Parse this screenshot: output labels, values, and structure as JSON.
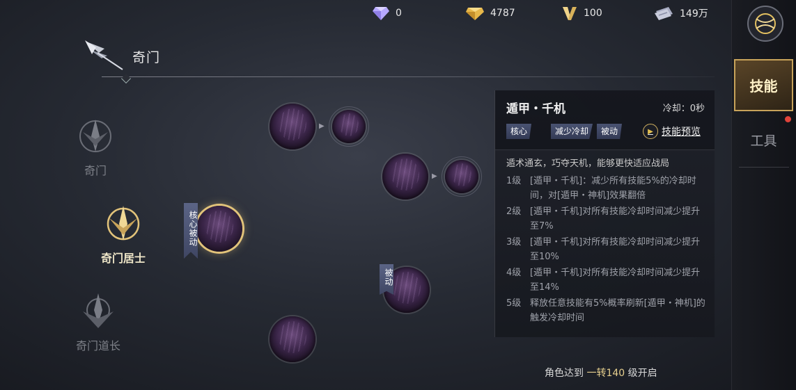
{
  "currencies": [
    {
      "icon": "diamond-icon",
      "value": "0"
    },
    {
      "icon": "gold-ingot-icon",
      "value": "4787"
    },
    {
      "icon": "v-points-icon",
      "value": "100"
    },
    {
      "icon": "silver-ticket-icon",
      "value": "149万"
    }
  ],
  "header": {
    "title": "奇门"
  },
  "classes": [
    {
      "label": "奇门",
      "state": "locked"
    },
    {
      "label": "奇门居士",
      "state": "active"
    },
    {
      "label": "奇门道长",
      "state": "locked"
    }
  ],
  "skill_tree": {
    "selected_tag": "核心被动",
    "passive_tag": "被动"
  },
  "skill_detail": {
    "name": "遁甲・千机",
    "cooldown": "冷却：0秒",
    "tags": [
      "核心",
      "减少冷却",
      "被动"
    ],
    "preview_label": "技能预览",
    "description": "遁术通玄，巧夺天机，能够更快适应战局",
    "levels": [
      {
        "level": "1级",
        "text": "[遁甲・千机]：减少所有技能5%的冷却时间，对[遁甲・神机]效果翻倍"
      },
      {
        "level": "2级",
        "text": "[遁甲・千机]对所有技能冷却时间减少提升至7%"
      },
      {
        "level": "3级",
        "text": "[遁甲・千机]对所有技能冷却时间减少提升至10%"
      },
      {
        "level": "4级",
        "text": "[遁甲・千机]对所有技能冷却时间减少提升至14%"
      },
      {
        "level": "5级",
        "text": "释放任意技能有5%概率刷新[遁甲・神机]的触发冷却时间"
      }
    ]
  },
  "unlock": {
    "prefix": "角色达到",
    "highlight": "一转140",
    "suffix": "级开启"
  },
  "sidebar": {
    "tabs": [
      {
        "label": "技能",
        "active": true
      },
      {
        "label": "工具",
        "active": false
      }
    ]
  },
  "colors": {
    "accent_gold": "#e2c37a",
    "tag_blue": "#4a5372",
    "notification_red": "#e0433a"
  }
}
